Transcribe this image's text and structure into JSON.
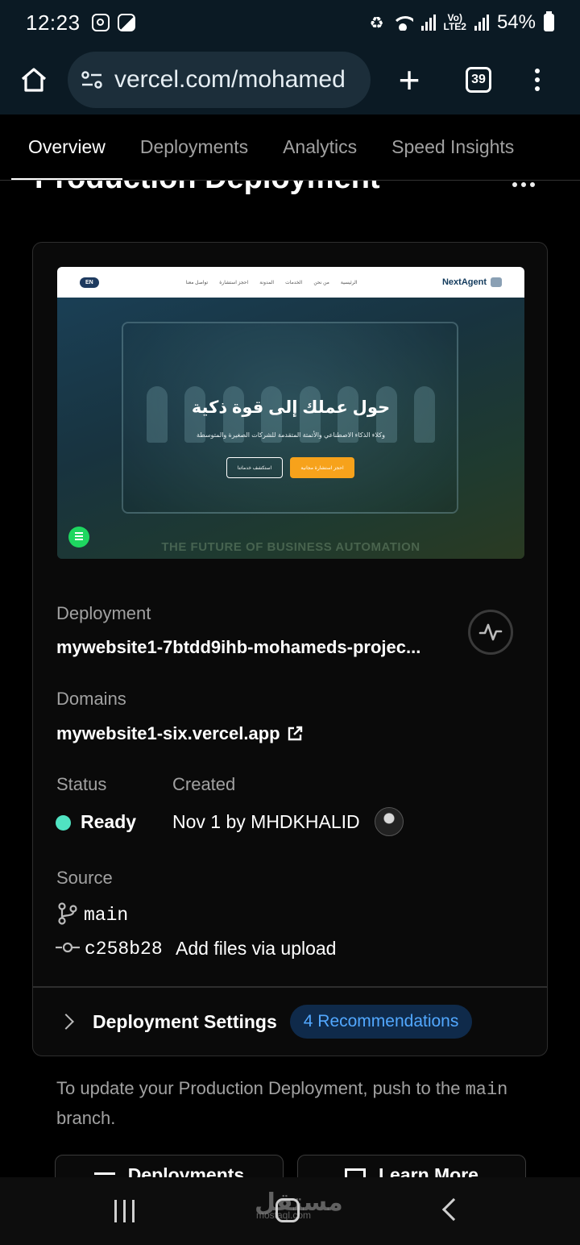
{
  "status_bar": {
    "time": "12:23",
    "network_small_top": "Vo)",
    "network_small_bottom": "LTE2",
    "battery": "54%"
  },
  "browser": {
    "url": "vercel.com/mohamed",
    "tab_count": "39"
  },
  "nav_tabs": [
    "Overview",
    "Deployments",
    "Analytics",
    "Speed Insights"
  ],
  "page": {
    "title": "Production Deployment"
  },
  "preview": {
    "lang_button": "EN",
    "nav_links": [
      "تواصل معنا",
      "احجز استشارة",
      "المدونة",
      "الخدمات",
      "من نحن",
      "الرئيسية"
    ],
    "logo": "NextAgent",
    "headline": "حول عملك إلى قوة ذكية",
    "subtitle": "وكلاء الذكاء الاصطناعي والأتمتة المتقدمة للشركات الصغيرة والمتوسطة",
    "btn_secondary": "استكشف خدماتنا",
    "btn_primary": "احجز استشارة مجانية",
    "banner": "THE FUTURE OF BUSINESS AUTOMATION"
  },
  "deployment": {
    "deployment_label": "Deployment",
    "deployment_value": "mywebsite1-7btdd9ihb-mohameds-projec...",
    "domains_label": "Domains",
    "domains_value": "mywebsite1-six.vercel.app",
    "status_label": "Status",
    "status_value": "Ready",
    "status_color": "#50e3c2",
    "created_label": "Created",
    "created_value": "Nov 1 by MHDKHALID",
    "source_label": "Source",
    "branch": "main",
    "commit_hash": "c258b28",
    "commit_message": "Add files via upload"
  },
  "settings": {
    "label": "Deployment Settings",
    "badge": "4 Recommendations"
  },
  "footer": {
    "text_before": "To update your Production Deployment, push to the",
    "branch": "main",
    "text_after": "branch."
  },
  "bottom_buttons": {
    "deployments": "Deployments",
    "learn_more": "Learn More"
  },
  "watermark": {
    "arabic": "مستقل",
    "latin": "mostaql.com"
  }
}
